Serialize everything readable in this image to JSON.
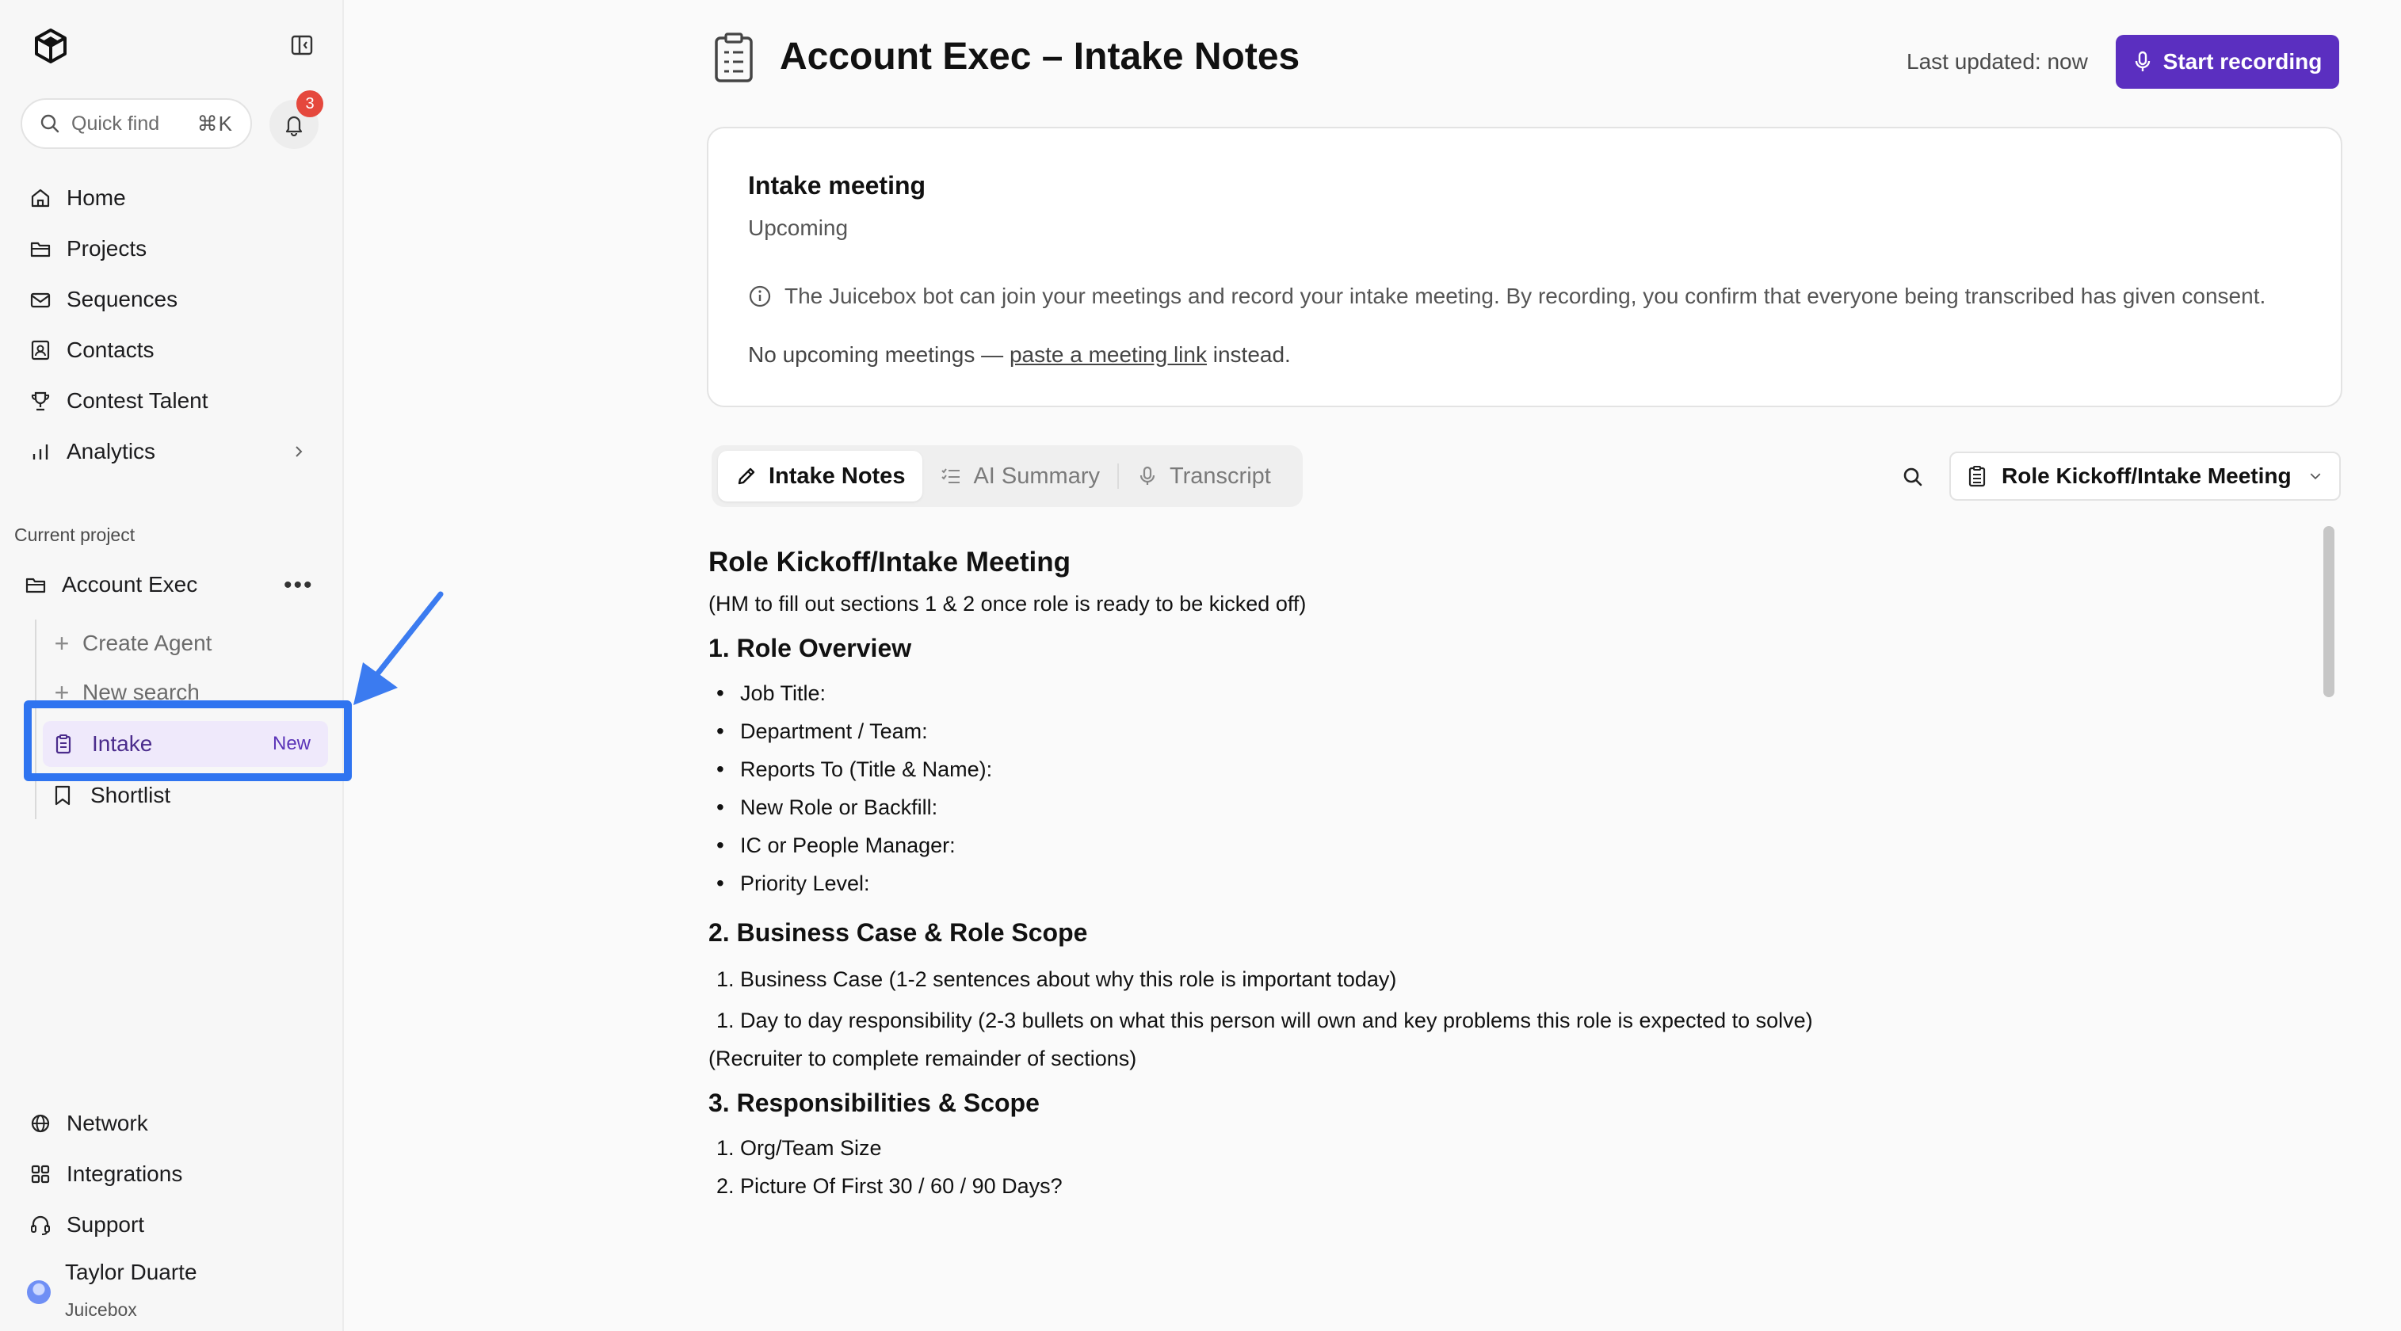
{
  "sidebar": {
    "quick_find": {
      "placeholder": "Quick find",
      "shortcut": "⌘K"
    },
    "notifications_count": "3",
    "nav": [
      {
        "label": "Home",
        "icon": "home-icon"
      },
      {
        "label": "Projects",
        "icon": "folder-icon"
      },
      {
        "label": "Sequences",
        "icon": "mail-icon"
      },
      {
        "label": "Contacts",
        "icon": "contact-icon"
      },
      {
        "label": "Contest Talent",
        "icon": "trophy-icon"
      },
      {
        "label": "Analytics",
        "icon": "chart-icon"
      }
    ],
    "section_label": "Current project",
    "project": {
      "name": "Account Exec",
      "create_agent": "Create Agent",
      "new_search": "New search",
      "intake": "Intake",
      "intake_badge": "New",
      "shortlist": "Shortlist"
    },
    "bottom_nav": [
      {
        "label": "Network",
        "icon": "globe-icon"
      },
      {
        "label": "Integrations",
        "icon": "grid-icon"
      },
      {
        "label": "Support",
        "icon": "headset-icon"
      }
    ],
    "user": {
      "name": "Taylor Duarte",
      "org": "Juicebox"
    }
  },
  "header": {
    "title": "Account Exec – Intake Notes",
    "last_updated": "Last updated: now",
    "record_button": "Start recording"
  },
  "meeting_card": {
    "title": "Intake meeting",
    "status": "Upcoming",
    "info": "The Juicebox bot can join your meetings and record your intake meeting. By recording, you confirm that everyone being transcribed has given consent.",
    "none_prefix": "No upcoming meetings — ",
    "none_link": "paste a meeting link",
    "none_suffix": " instead."
  },
  "tabs": [
    {
      "label": "Intake Notes",
      "active": true
    },
    {
      "label": "AI Summary",
      "active": false
    },
    {
      "label": "Transcript",
      "active": false
    }
  ],
  "doc_select": {
    "label": "Role Kickoff/Intake Meeting"
  },
  "document": {
    "title": "Role Kickoff/Intake Meeting",
    "subtitle": "(HM to fill out sections 1 & 2 once role is ready to be kicked off)",
    "section1": {
      "heading": "1. Role Overview",
      "items": [
        "Job Title:",
        "Department / Team:",
        "Reports To (Title & Name):",
        "New Role or Backfill:",
        "IC or People Manager:",
        "Priority Level:"
      ]
    },
    "section2": {
      "heading": "2. Business Case & Role Scope",
      "items": [
        {
          "num": "1.",
          "text": "Business Case (1-2 sentences about why this role is important today)"
        },
        {
          "num": "1.",
          "text": "Day to day responsibility (2-3 bullets on what this person will own and key problems this role is expected to solve)"
        }
      ],
      "note": "(Recruiter to complete remainder of sections)"
    },
    "section3": {
      "heading": "3. Responsibilities & Scope",
      "items": [
        {
          "num": "1.",
          "text": "Org/Team Size"
        },
        {
          "num": "2.",
          "text": "Picture Of First 30 / 60 / 90 Days?"
        }
      ]
    }
  },
  "colors": {
    "accent": "#5b2fc0",
    "highlight": "#2f74f0",
    "badge": "#e5483d",
    "intake_bg": "#efe9fb"
  }
}
